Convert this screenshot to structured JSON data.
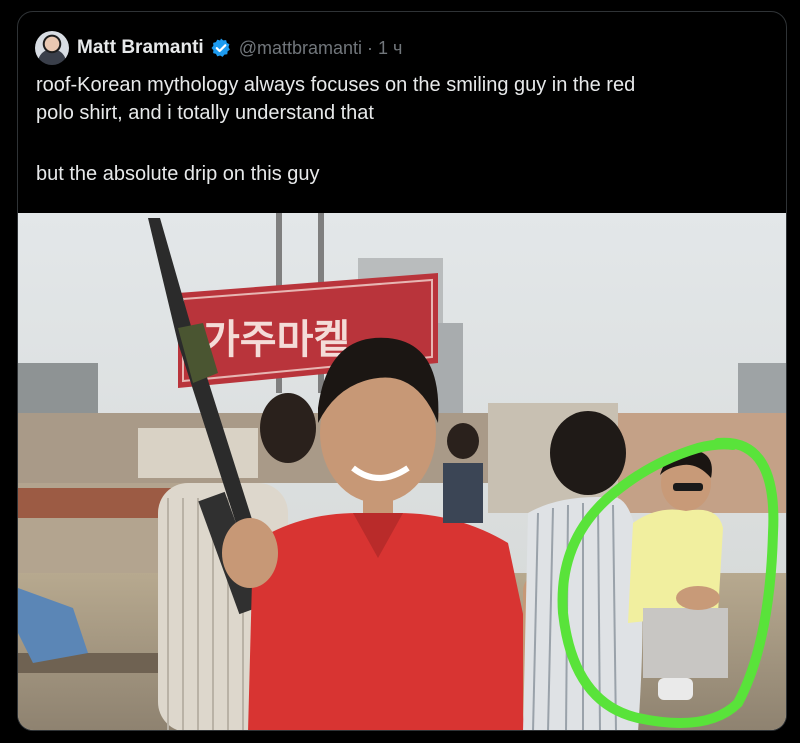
{
  "tweet": {
    "author_name": "Matt Bramanti",
    "handle": "@mattbramanti",
    "separator": "·",
    "timestamp": "1 ч",
    "verified_icon": "verified-badge-icon",
    "avatar_icon": "profile-avatar",
    "text_lines": [
      "roof-Korean mythology always focuses on the smiling guy in the red",
      "polo shirt, and i totally understand that",
      "but the absolute drip on this guy"
    ],
    "media": {
      "sign_text": "가주마켙",
      "highlight_color": "#59e33a"
    }
  },
  "colors": {
    "background": "#000000",
    "text_primary": "#e7e9ea",
    "text_secondary": "#71767b",
    "verified_blue": "#1d9bf0",
    "border": "#2f3336"
  }
}
